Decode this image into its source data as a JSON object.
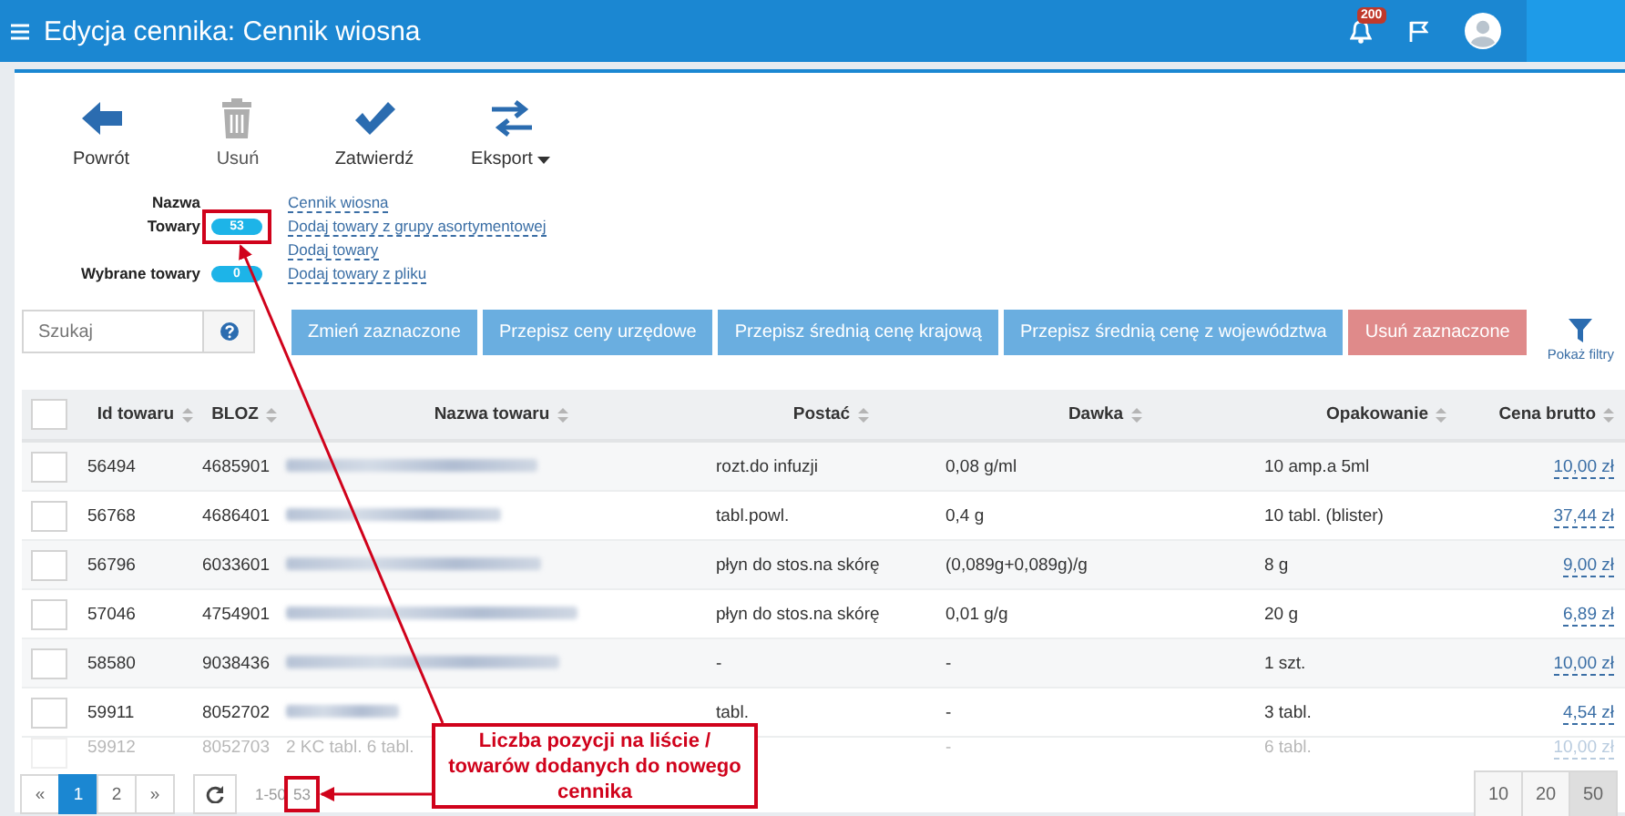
{
  "app_bar": {
    "title": "Edycja cennika: Cennik wiosna",
    "notification_count": "200"
  },
  "toolbar": [
    {
      "label": "Powrót",
      "disabled": false,
      "dropdown": false
    },
    {
      "label": "Usuń",
      "disabled": true,
      "dropdown": false
    },
    {
      "label": "Zatwierdź",
      "disabled": false,
      "dropdown": false
    },
    {
      "label": "Eksport",
      "disabled": false,
      "dropdown": true
    }
  ],
  "details": [
    {
      "label": "Nazwa",
      "link": "Cennik wiosna"
    },
    {
      "label": "Towary",
      "badge": "53",
      "link": "Dodaj towary z grupy asortymentowej"
    },
    {
      "link": "Dodaj towary"
    },
    {
      "label": "Wybrane towary",
      "badge": "0",
      "link": "Dodaj towary z pliku"
    }
  ],
  "search": {
    "placeholder": "Szukaj"
  },
  "actions": [
    {
      "label": "Zmień zaznaczone",
      "kind": "primary"
    },
    {
      "label": "Przepisz ceny urzędowe",
      "kind": "primary"
    },
    {
      "label": "Przepisz średnią cenę krajową",
      "kind": "primary"
    },
    {
      "label": "Przepisz średnią cenę z województwa",
      "kind": "primary"
    },
    {
      "label": "Usuń zaznaczone",
      "kind": "danger"
    }
  ],
  "filters_toggle": "Pokaż filtry",
  "table": {
    "all_checked": false,
    "columns": [
      "Id towaru",
      "BLOZ",
      "Nazwa towaru",
      "Postać",
      "Dawka",
      "Opakowanie",
      "Cena brutto"
    ],
    "rows": [
      {
        "checked": false,
        "faded": false,
        "id": "56494",
        "bloz": "4685901",
        "name_blurred": true,
        "form": "rozt.do infuzji",
        "dose": "0,08 g/ml",
        "package": "10 amp.a 5ml",
        "price": "10,00 zł"
      },
      {
        "checked": false,
        "faded": false,
        "id": "56768",
        "bloz": "4686401",
        "name_blurred": true,
        "form": "tabl.powl.",
        "dose": "0,4 g",
        "package": "10 tabl. (blister)",
        "price": "37,44 zł"
      },
      {
        "checked": false,
        "faded": false,
        "id": "56796",
        "bloz": "6033601",
        "name_blurred": true,
        "form": "płyn do stos.na skórę",
        "dose": "(0,089g+0,089g)/g",
        "package": "8 g",
        "price": "9,00 zł"
      },
      {
        "checked": false,
        "faded": false,
        "id": "57046",
        "bloz": "4754901",
        "name_blurred": true,
        "form": "płyn do stos.na skórę",
        "dose": "0,01 g/g",
        "package": "20 g",
        "price": "6,89 zł"
      },
      {
        "checked": false,
        "faded": false,
        "id": "58580",
        "bloz": "9038436",
        "name_blurred": true,
        "form": "-",
        "dose": "-",
        "package": "1 szt.",
        "price": "10,00 zł"
      },
      {
        "checked": false,
        "faded": false,
        "id": "59911",
        "bloz": "8052702",
        "name_blurred": true,
        "form": "tabl.",
        "dose": "-",
        "package": "3 tabl.",
        "price": "4,54 zł"
      },
      {
        "checked": false,
        "faded": true,
        "id": "59912",
        "bloz": "8052703",
        "name": "2 KC tabl. 6 tabl.",
        "name_blurred": false,
        "dose": "-",
        "package": "6 tabl.",
        "price": "10,00 zł"
      }
    ]
  },
  "pagination": {
    "prev": "«",
    "next": "»",
    "pages": [
      {
        "label": "1",
        "selected": true
      },
      {
        "label": "2",
        "selected": false
      }
    ],
    "range": "1-50",
    "total": "53",
    "page_sizes": [
      {
        "label": "10",
        "selected": false
      },
      {
        "label": "20",
        "selected": false
      },
      {
        "label": "50",
        "selected": true
      }
    ]
  },
  "annotation": {
    "text": "Liczba pozycji na liście / towarów dodanych do nowego cennika"
  }
}
